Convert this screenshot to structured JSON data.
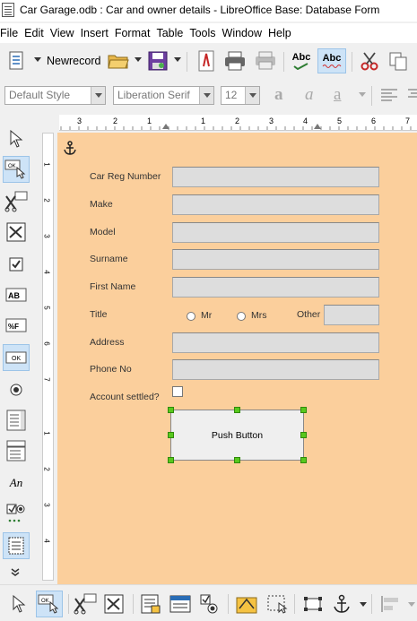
{
  "window": {
    "title": "Car Garage.odb : Car and owner details - LibreOffice Base: Database Form"
  },
  "menu": [
    "File",
    "Edit",
    "View",
    "Insert",
    "Format",
    "Table",
    "Tools",
    "Window",
    "Help"
  ],
  "toolbar": {
    "new_record_label": "Newrecord",
    "spellcheck_label": "Abc",
    "autospell_label": "Abc"
  },
  "formatting": {
    "paragraph_style": "Default Style",
    "font_name": "Liberation Serif",
    "font_size": "12"
  },
  "form": {
    "labels": {
      "car_reg": "Car Reg Number",
      "make": "Make",
      "model": "Model",
      "surname": "Surname",
      "first_name": "First Name",
      "title": "Title",
      "mr": "Mr",
      "mrs": "Mrs",
      "other": "Other",
      "address": "Address",
      "phone": "Phone No",
      "account_settled": "Account settled?"
    },
    "push_button_label": "Push Button"
  },
  "icons": {
    "ok_button": "OK",
    "ok_small": "OK",
    "number_field": "%F",
    "italic_text": "An",
    "label_field": "AB"
  },
  "ruler_marks": [
    "3",
    "2",
    "1",
    "1",
    "2",
    "3",
    "4",
    "5",
    "6",
    "7"
  ],
  "vruler_marks": [
    "1",
    "2",
    "3",
    "4",
    "5",
    "6",
    "7",
    "1",
    "2",
    "3",
    "4"
  ]
}
